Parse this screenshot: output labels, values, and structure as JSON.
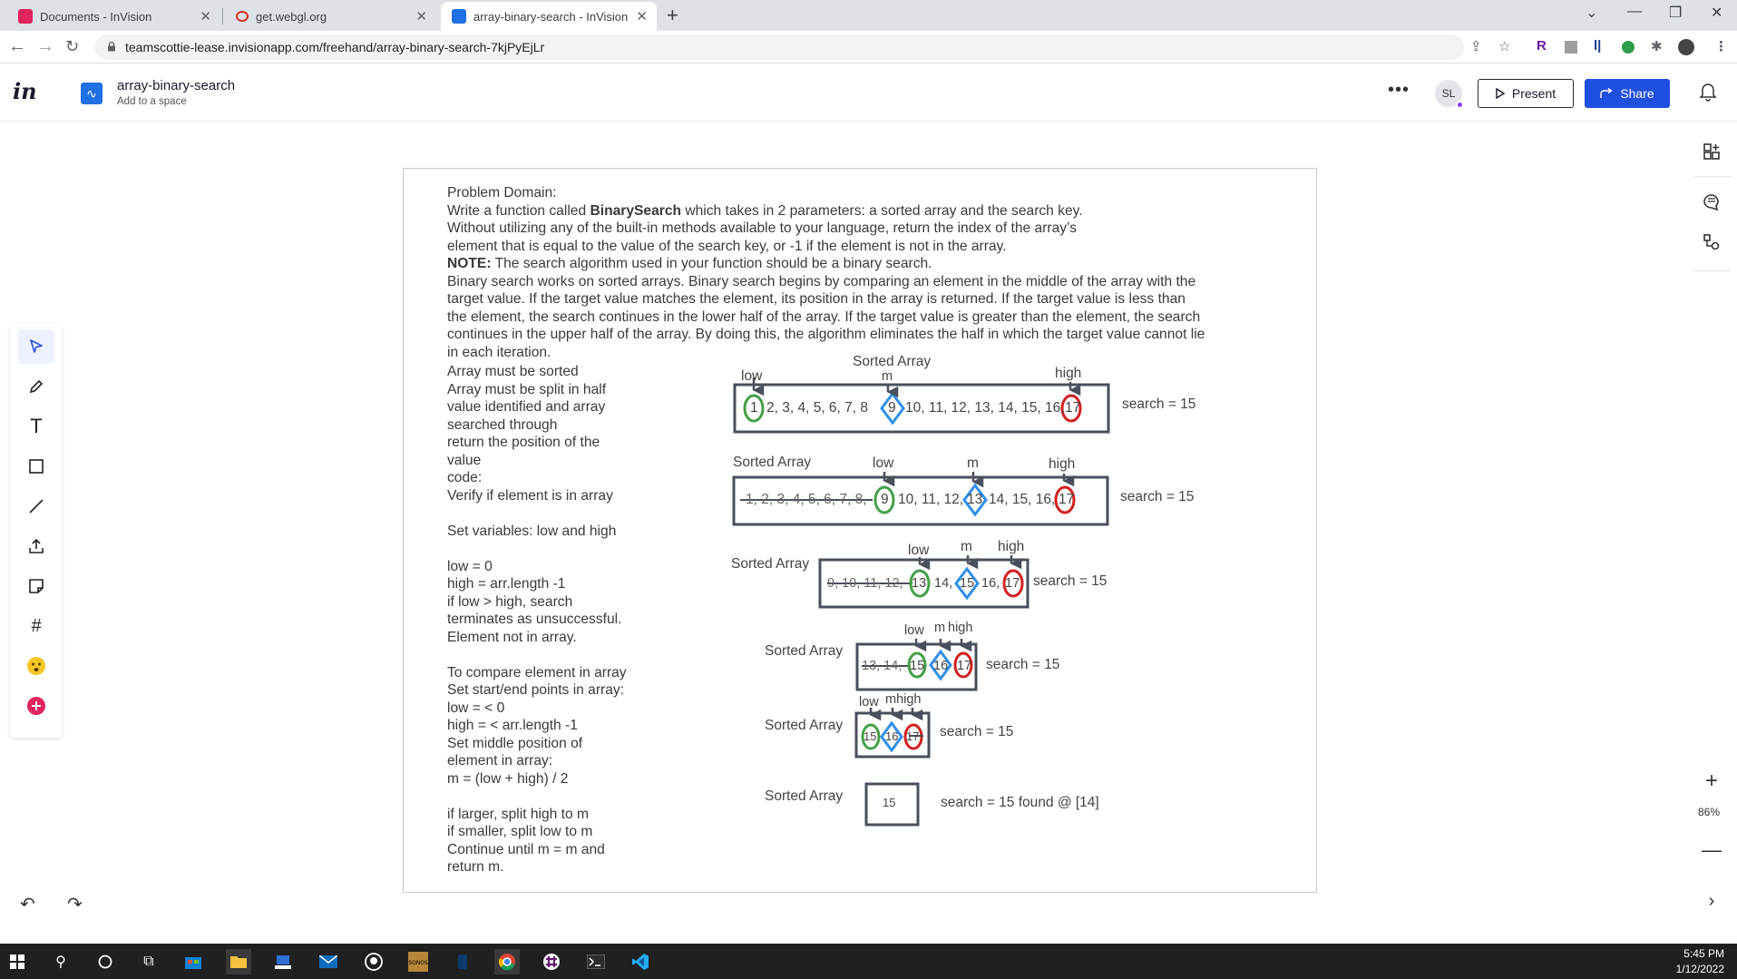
{
  "browser": {
    "tabs": [
      {
        "title": "Documents - InVision",
        "active": false
      },
      {
        "title": "get.webgl.org",
        "active": false
      },
      {
        "title": "array-binary-search - InVision",
        "active": true
      }
    ],
    "url": "teamscottie-lease.invisionapp.com/freehand/array-binary-search-7kjPyEjLr"
  },
  "header": {
    "logo": "in",
    "doc_title": "array-binary-search",
    "doc_subtitle": "Add to a space",
    "avatar_initials": "SL",
    "present_label": "Present",
    "share_label": "Share",
    "accent_color": "#1f4fe0"
  },
  "zoom": "86%",
  "problem": {
    "heading": "Problem Domain:",
    "line1_pre": "Write a function called ",
    "line1_bold": "BinarySearch",
    "line1_post": " which takes in 2 parameters: a sorted array and the search key.",
    "line2": "Without utilizing any of the built-in methods available to your language, return the index of the array’s",
    "line3": "element that is equal to the value of the search key, or -1 if the element is not in the array.",
    "note_bold": "NOTE:",
    "note_rest": " The search algorithm used in your function should be a binary search.",
    "para1": "Binary search works on sorted arrays. Binary search begins by comparing an element in the middle of the array with the",
    "para2": "target value. If the target value matches the element, its position in the array is returned. If the target value is less than",
    "para3": "the element, the search continues in the lower half of the array. If the target value is greater than the element, the search",
    "para4": "continues in the upper half of the array. By doing this, the algorithm eliminates the half in which the target value cannot lie",
    "para5": "in each iteration."
  },
  "notes": [
    "Array must be sorted",
    "Array must be split in half",
    "value identified and array",
    "searched through",
    "return the position of the",
    "value",
    "code:",
    "Verify if element is in array",
    "",
    "Set variables: low and high",
    "",
    "low = 0",
    "high = arr.length -1",
    "if low > high, search",
    "terminates as unsuccessful.",
    "Element not in array.",
    "",
    "To compare element in array",
    "Set start/end points in array:",
    "low = < 0",
    "high = < arr.length -1",
    "Set middle position of",
    "element in array:",
    "m = (low + high) / 2",
    "",
    "if larger, split high to m",
    "if smaller, split low to m",
    "Continue until m = m and",
    "return m."
  ],
  "diagram": {
    "sorted_label": "Sorted Array",
    "low": "low",
    "m": "m",
    "high": "high",
    "mhigh": "mhigh",
    "search": "search = 15",
    "found": "search = 15 found @ [14]",
    "row1_values": "1, 2, 3, 4, 5, 6, 7, 8, 9, 10, 11, 12, 13, 14, 15, 16, 17",
    "row1_a": "1",
    "row1_b": "2, 3, 4, 5, 6, 7, 8",
    "row1_c": "9",
    "row1_d": "10, 11, 12, 13, 14, 15, 16,",
    "row1_e": "17",
    "row2_struck": "1, 2, 3, 4, 5, 6, 7, 8,",
    "row2_a": "9",
    "row2_b": "10, 11, 12,",
    "row2_c": "13",
    "row2_d": "14, 15, 16,",
    "row2_e": "17",
    "row3_struck": "9, 10, 11, 12,",
    "row3_a": "13",
    "row3_b": "14,",
    "row3_c": "15",
    "row3_d": "16,",
    "row3_e": "17",
    "row4_struck": "13, 14,",
    "row4_a": "15",
    "row4_b": "16",
    "row4_c": "17",
    "row5_a": "15",
    "row5_b": "16",
    "row5_c": "17",
    "row6_value": "15",
    "colors": {
      "low": "#43a047",
      "mid": "#2f8fe8",
      "high": "#d21f1f",
      "ink": "#4a4f5c"
    }
  },
  "taskbar": {
    "time": "5:45 PM",
    "date": "1/12/2022"
  }
}
